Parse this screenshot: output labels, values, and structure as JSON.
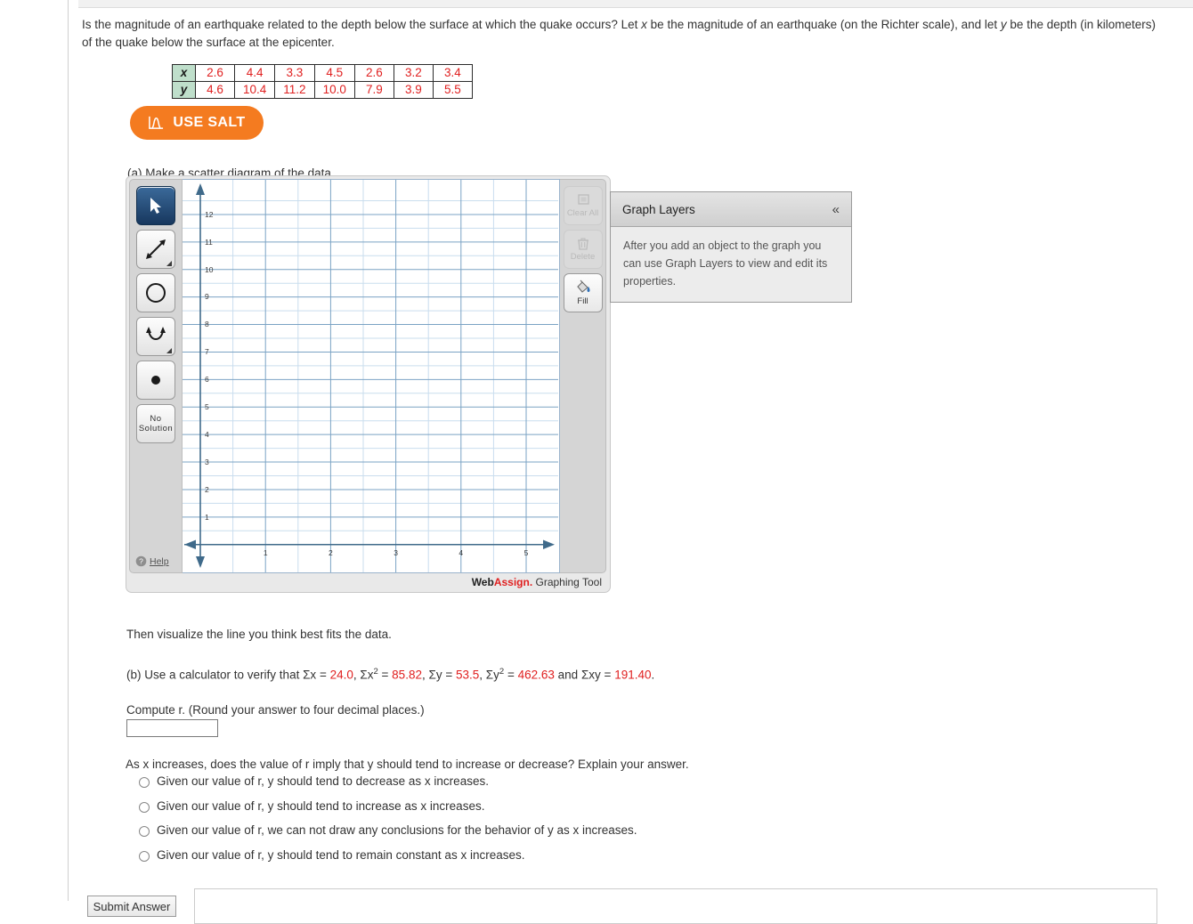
{
  "question": {
    "line1_a": "Is the magnitude of an earthquake related to the depth below the surface at which the quake occurs? Let ",
    "var_x": "x",
    "line1_b": " be the magnitude of an earthquake (on the Richter scale), and let ",
    "var_y": "y",
    "line1_c": " be the",
    "line2": "depth (in kilometers) of the quake below the surface at the epicenter."
  },
  "table": {
    "row_x_label": "x",
    "row_y_label": "y",
    "x_values": [
      "2.6",
      "4.4",
      "3.3",
      "4.5",
      "2.6",
      "3.2",
      "3.4"
    ],
    "y_values": [
      "4.6",
      "10.4",
      "11.2",
      "10.0",
      "7.9",
      "3.9",
      "5.5"
    ],
    "header_bg": "#bfdfcb",
    "value_color": "#e02020"
  },
  "salt_button": {
    "label": "USE SALT",
    "icon": "salt-distribution-icon",
    "color": "#f47b20"
  },
  "parts": {
    "a_label": "(a) Make a scatter diagram of the data.",
    "visualize_line": "Then visualize the line you think best fits the data.",
    "b_prefix": "(b) Use a calculator to verify that Σ",
    "sum_x_label": "Σx",
    "sum_x": "24.0",
    "sum_x2_label": "Σx",
    "sum_x2": "85.82",
    "sum_y_label": "Σy",
    "sum_y": "53.5",
    "sum_y2_label": "Σy",
    "sum_y2": "462.63",
    "sum_xy_label": "Σxy",
    "sum_xy": "191.40",
    "and_word": "and",
    "period": ".",
    "compute_r": "Compute r. (Round your answer to four decimal places.)",
    "answer_value": "",
    "answer_placeholder": ""
  },
  "mc": {
    "prompt": "As x increases, does the value of r imply that y should tend to increase or decrease? Explain your answer.",
    "options": [
      "Given our value of r, y should tend to decrease as x increases.",
      "Given our value of r, y should tend to increase as x increases.",
      "Given our value of r, we can not draw any conclusions for the behavior of y as x increases.",
      "Given our value of r, y should tend to remain constant as x increases."
    ],
    "selected": -1
  },
  "graph_tool": {
    "toolbar": [
      {
        "name": "select-tool",
        "label": "Select",
        "active": true,
        "has_flyout": false
      },
      {
        "name": "line-tool",
        "label": "Line",
        "active": false,
        "has_flyout": true
      },
      {
        "name": "circle-tool",
        "label": "Circle",
        "active": false,
        "has_flyout": false
      },
      {
        "name": "parabola-tool",
        "label": "Parabola",
        "active": false,
        "has_flyout": true
      },
      {
        "name": "point-tool",
        "label": "Point",
        "active": false,
        "has_flyout": false
      },
      {
        "name": "no-solution-tool",
        "label": "No Solution",
        "active": false,
        "has_flyout": false
      }
    ],
    "no_solution_line1": "No",
    "no_solution_line2": "Solution",
    "help_label": "Help",
    "actions": [
      {
        "name": "clear-all-button",
        "label": "Clear All",
        "enabled": false
      },
      {
        "name": "delete-button",
        "label": "Delete",
        "enabled": false
      },
      {
        "name": "fill-button",
        "label": "Fill",
        "enabled": true
      }
    ],
    "brand_web": "Web",
    "brand_assign": "Assign.",
    "brand_tool": " Graphing Tool"
  },
  "layers_panel": {
    "title": "Graph Layers",
    "collapse_icon": "«",
    "body": "After you add an object to the graph you can use Graph Layers to view and edit its properties."
  },
  "chart_data": {
    "type": "scatter",
    "title": "",
    "xlabel": "",
    "ylabel": "",
    "xlim": [
      -0.4,
      5.6
    ],
    "ylim": [
      -0.9,
      12.9
    ],
    "xticks": [
      1,
      2,
      3,
      4,
      5
    ],
    "yticks": [
      1,
      2,
      3,
      4,
      5,
      6,
      7,
      8,
      9,
      10,
      11,
      12
    ],
    "minor_step": 0.5,
    "grid": true,
    "points": [],
    "axis_color": "#4f7da0",
    "grid_major_color": "#7ba3c4",
    "grid_minor_color": "#c6dced"
  },
  "footer": {
    "submit_label": "Submit Answer"
  }
}
